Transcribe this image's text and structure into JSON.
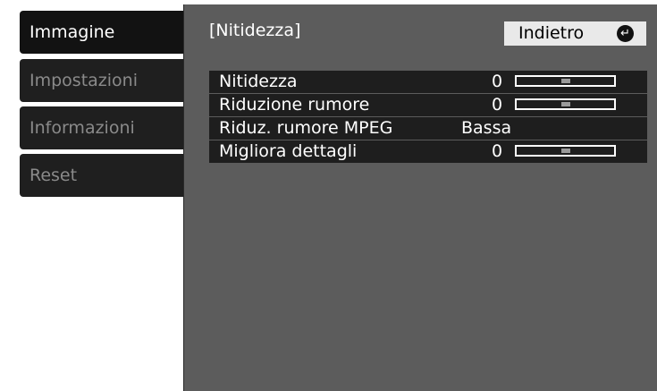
{
  "sidebar": {
    "items": [
      {
        "label": "Immagine"
      },
      {
        "label": "Impostazioni"
      },
      {
        "label": "Informazioni"
      },
      {
        "label": "Reset"
      }
    ]
  },
  "panel": {
    "title": "[Nitidezza]",
    "back_label": "Indietro",
    "back_icon": "enter-icon"
  },
  "settings": [
    {
      "label": "Nitidezza",
      "value": "0",
      "level": 0.5
    },
    {
      "label": "Riduzione rumore",
      "value": "0",
      "level": 0.5
    },
    {
      "label": "Riduz. rumore MPEG",
      "value": "Bassa"
    },
    {
      "label": "Migliora dettagli",
      "value": "0",
      "level": 0.5
    }
  ]
}
